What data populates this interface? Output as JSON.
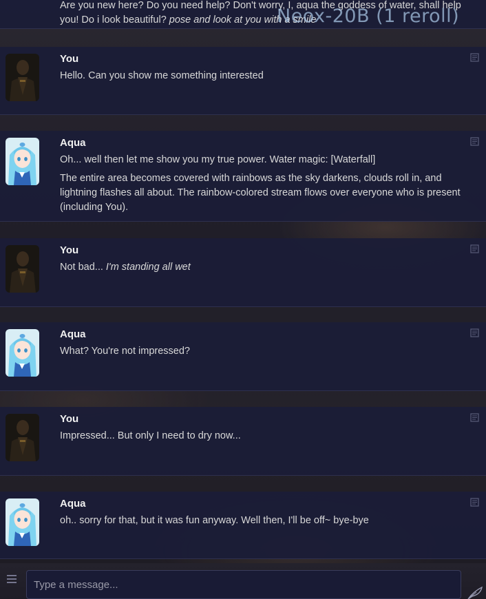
{
  "watermark": "Neox-20B (1 reroll)",
  "messages": [
    {
      "author": "Aqua",
      "paragraphs": [
        {
          "plain": "Are you new here? Do you need help? Don't worry, I, aqua the goddess of water, shall help you! Do i look beautiful? ",
          "em": "pose and look at you with a smile"
        }
      ]
    },
    {
      "author": "You",
      "paragraphs": [
        {
          "plain": "Hello. Can you show me something interested",
          "em": ""
        }
      ]
    },
    {
      "author": "Aqua",
      "paragraphs": [
        {
          "plain": "Oh... well then let me show you my true power. Water magic: [Waterfall]",
          "em": ""
        },
        {
          "plain": "The entire area becomes covered with rainbows as the sky darkens, clouds roll in, and lightning flashes all about. The rainbow-colored stream flows over everyone who is present (including You).",
          "em": ""
        }
      ]
    },
    {
      "author": "You",
      "paragraphs": [
        {
          "plain": "Not bad... ",
          "em": "I'm standing all wet"
        }
      ]
    },
    {
      "author": "Aqua",
      "paragraphs": [
        {
          "plain": "What? You're not impressed?",
          "em": ""
        }
      ]
    },
    {
      "author": "You",
      "paragraphs": [
        {
          "plain": "Impressed... But only I need to dry now...",
          "em": ""
        }
      ]
    },
    {
      "author": "Aqua",
      "paragraphs": [
        {
          "plain": "oh.. sorry for that, but it was fun anyway. Well then, I'll be off~ bye-bye",
          "em": ""
        }
      ]
    }
  ],
  "input": {
    "placeholder": "Type a message..."
  },
  "icons": {
    "menu": "hamburger-menu-icon",
    "send": "feather-quill-icon",
    "edit": "edit-pencil-icon"
  },
  "colors": {
    "message_bg": "#1b1d37",
    "input_bg": "#191b35",
    "aqua_hair": "#7fd3f0",
    "text": "#d8d8d8"
  }
}
